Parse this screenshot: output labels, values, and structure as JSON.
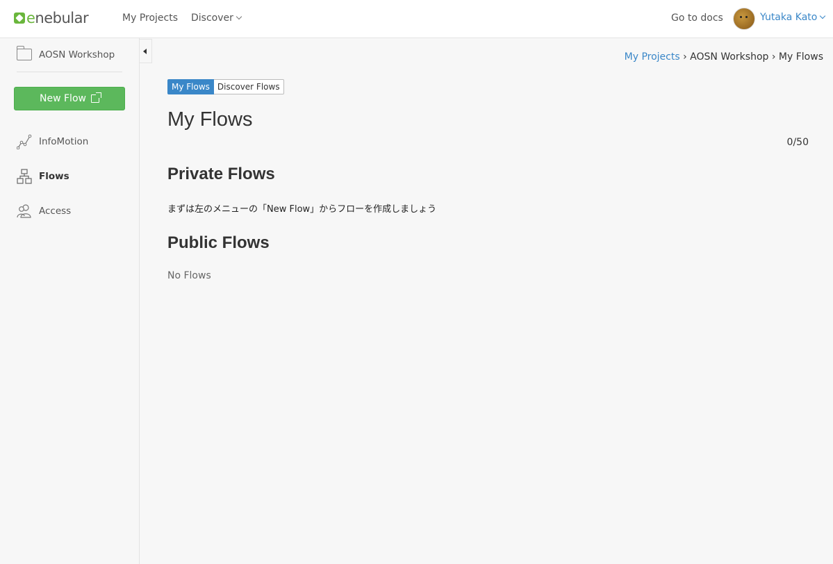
{
  "header": {
    "logo_text": "enebular",
    "nav": {
      "my_projects": "My Projects",
      "discover": "Discover"
    },
    "docs": "Go to docs",
    "user_name": "Yutaka Kato"
  },
  "sidebar": {
    "project_name": "AOSN Workshop",
    "new_flow_label": "New Flow",
    "items": [
      {
        "label": "InfoMotion",
        "icon": "infomotion-icon"
      },
      {
        "label": "Flows",
        "icon": "flows-icon"
      },
      {
        "label": "Access",
        "icon": "users-icon"
      }
    ]
  },
  "breadcrumb": {
    "root": "My Projects",
    "sep": "›",
    "project": "AOSN Workshop",
    "current": "My Flows"
  },
  "tabs": {
    "my_flows": "My Flows",
    "discover_flows": "Discover Flows"
  },
  "main": {
    "title": "My Flows",
    "count": "0/50",
    "private_title": "Private Flows",
    "private_hint": "まずは左のメニューの「New Flow」からフローを作成しましょう",
    "public_title": "Public Flows",
    "public_empty": "No Flows"
  },
  "colors": {
    "brand_green": "#6ab63c",
    "button_green": "#5cb85c",
    "link_blue": "#3a87c8"
  }
}
